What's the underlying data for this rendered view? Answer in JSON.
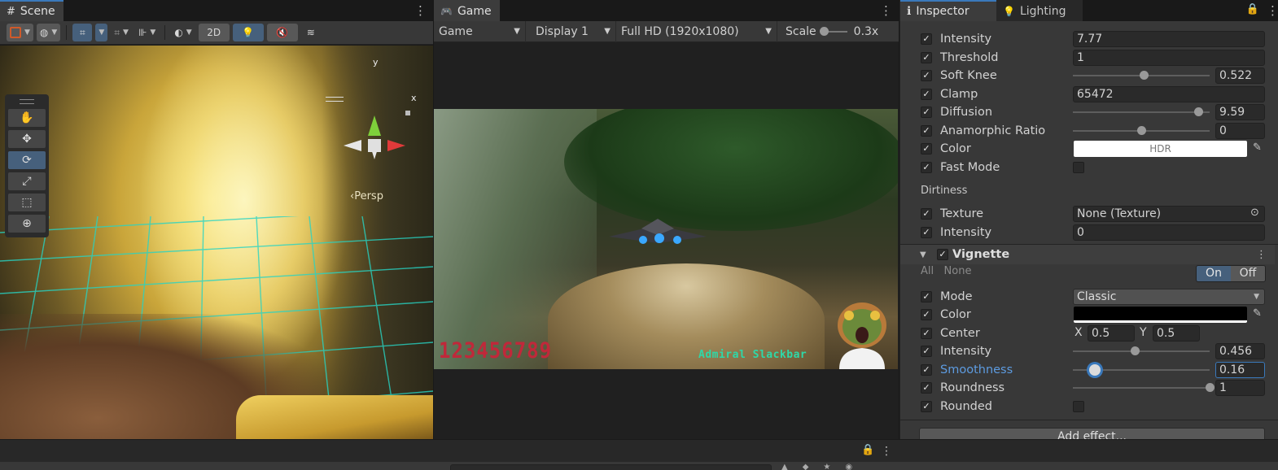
{
  "scene": {
    "tab_label": "Scene",
    "toolbar": {
      "mode_2d": "2D"
    },
    "gizmo": {
      "y_label": "y",
      "x_label": "x",
      "persp_label": "Persp"
    }
  },
  "game": {
    "tab_label": "Game",
    "toolbar": {
      "view_select": "Game",
      "display_select": "Display 1",
      "resolution_select": "Full HD (1920x1080)",
      "scale_label": "Scale",
      "scale_value": "0.3x",
      "scale_fraction": 0.0
    },
    "hud": {
      "score": "123456789",
      "pilot_name": "Admiral Slackbar"
    }
  },
  "inspector": {
    "tabs": [
      {
        "label": "Inspector"
      },
      {
        "label": "Lighting"
      }
    ],
    "bloom": {
      "intensity": {
        "label": "Intensity",
        "value": "7.77"
      },
      "threshold": {
        "label": "Threshold",
        "value": "1"
      },
      "soft_knee": {
        "label": "Soft Knee",
        "value": "0.522",
        "fraction": 0.522
      },
      "clamp": {
        "label": "Clamp",
        "value": "65472"
      },
      "diffusion": {
        "label": "Diffusion",
        "value": "9.59",
        "fraction": 0.922
      },
      "anamorphic_ratio": {
        "label": "Anamorphic Ratio",
        "value": "0",
        "fraction": 0.5
      },
      "color": {
        "label": "Color",
        "value_text": "HDR",
        "swatch": "#ffffff"
      },
      "fast_mode": {
        "label": "Fast Mode"
      },
      "dirtiness_header": "Dirtiness",
      "texture": {
        "label": "Texture",
        "value": "None (Texture)"
      },
      "dirt_intensity": {
        "label": "Intensity",
        "value": "0"
      }
    },
    "vignette": {
      "title": "Vignette",
      "all_label": "All",
      "none_label": "None",
      "on_label": "On",
      "off_label": "Off",
      "mode": {
        "label": "Mode",
        "value": "Classic"
      },
      "color": {
        "label": "Color",
        "swatch": "#000000"
      },
      "center": {
        "label": "Center",
        "x_label": "X",
        "x": "0.5",
        "y_label": "Y",
        "y": "0.5"
      },
      "intensity": {
        "label": "Intensity",
        "value": "0.456",
        "fraction": 0.456
      },
      "smoothness": {
        "label": "Smoothness",
        "value": "0.16",
        "fraction": 0.16
      },
      "roundness": {
        "label": "Roundness",
        "value": "1",
        "fraction": 1.0
      },
      "rounded": {
        "label": "Rounded"
      }
    },
    "add_effect_label": "Add effect..."
  },
  "colors": {
    "accent": "#3a79bb",
    "highlight_label": "#5d9be0",
    "score_red": "#c0283a",
    "pilot_teal": "#2ed8a8"
  }
}
